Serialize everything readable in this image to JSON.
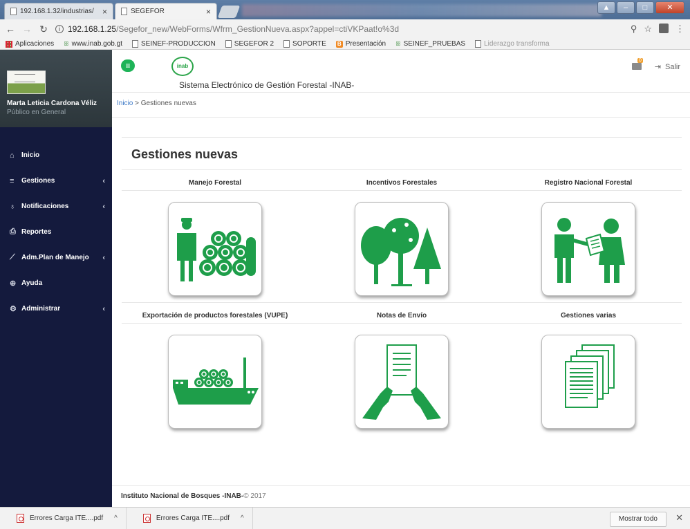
{
  "browser": {
    "tabs": [
      {
        "title": "192.168.1.32/industrias/"
      },
      {
        "title": "SEGEFOR"
      }
    ],
    "url_host": "192.168.1.25",
    "url_rest": "/Segefor_new/WebForms/Wfrm_GestionNueva.aspx?appel=ctiVKPaat!o%3d",
    "bookmarks": [
      {
        "label": "Aplicaciones",
        "icon": "apps-grid-icon"
      },
      {
        "label": "www.inab.gob.gt",
        "icon": "inab-icon"
      },
      {
        "label": "SEINEF-PRODUCCION",
        "icon": "page-icon"
      },
      {
        "label": "SEGEFOR 2",
        "icon": "page-icon"
      },
      {
        "label": "SOPORTE",
        "icon": "page-icon"
      },
      {
        "label": "Presentación",
        "icon": "blogger-icon"
      },
      {
        "label": "SEINEF_PRUEBAS",
        "icon": "inab-icon"
      },
      {
        "label": "Liderazgo transforma",
        "icon": "page-icon"
      }
    ]
  },
  "sidebar": {
    "user_name": "Marta Leticia Cardona Véliz",
    "user_role": "Público en General",
    "items": [
      {
        "label": "Inicio",
        "icon": "home-icon",
        "caret": ""
      },
      {
        "label": "Gestiones",
        "icon": "list-icon",
        "caret": "‹"
      },
      {
        "label": "Notificaciones",
        "icon": "bell-icon",
        "caret": "‹"
      },
      {
        "label": "Reportes",
        "icon": "print-icon",
        "caret": ""
      },
      {
        "label": "Adm.Plan de Manejo",
        "icon": "chart-icon",
        "caret": "‹"
      },
      {
        "label": "Ayuda",
        "icon": "help-icon",
        "caret": ""
      },
      {
        "label": "Administrar",
        "icon": "gear-icon",
        "caret": "‹"
      }
    ]
  },
  "header": {
    "logo_text": "inab",
    "system_title": "Sistema Electrónico de Gestión Forestal -INAB-",
    "notification_count": "0",
    "logout_label": "Salir"
  },
  "breadcrumb": {
    "home": "Inicio",
    "separator": " > ",
    "current": "Gestiones nuevas"
  },
  "page": {
    "title": "Gestiones nuevas",
    "cards": [
      {
        "label": "Manejo Forestal",
        "icon": "forester-logs-icon"
      },
      {
        "label": "Incentivos Forestales",
        "icon": "forest-trees-icon"
      },
      {
        "label": "Registro Nacional Forestal",
        "icon": "registry-people-icon"
      },
      {
        "label": "Exportación de productos forestales (VUPE)",
        "icon": "cargo-ship-icon"
      },
      {
        "label": "Notas de Envío",
        "icon": "hands-document-icon"
      },
      {
        "label": "Gestiones varias",
        "icon": "documents-stack-icon"
      }
    ]
  },
  "footer": {
    "org": "Instituto Nacional de Bosques -INAB-",
    "copyright": "© 2017"
  },
  "downloads": {
    "items": [
      {
        "name": "Errores Carga ITE....pdf"
      },
      {
        "name": "Errores Carga ITE....pdf"
      }
    ],
    "show_all": "Mostrar todo"
  },
  "colors": {
    "sidebar_bg": "#141a3d",
    "accent_green": "#1e9e4a",
    "link_blue": "#3b78c6"
  }
}
